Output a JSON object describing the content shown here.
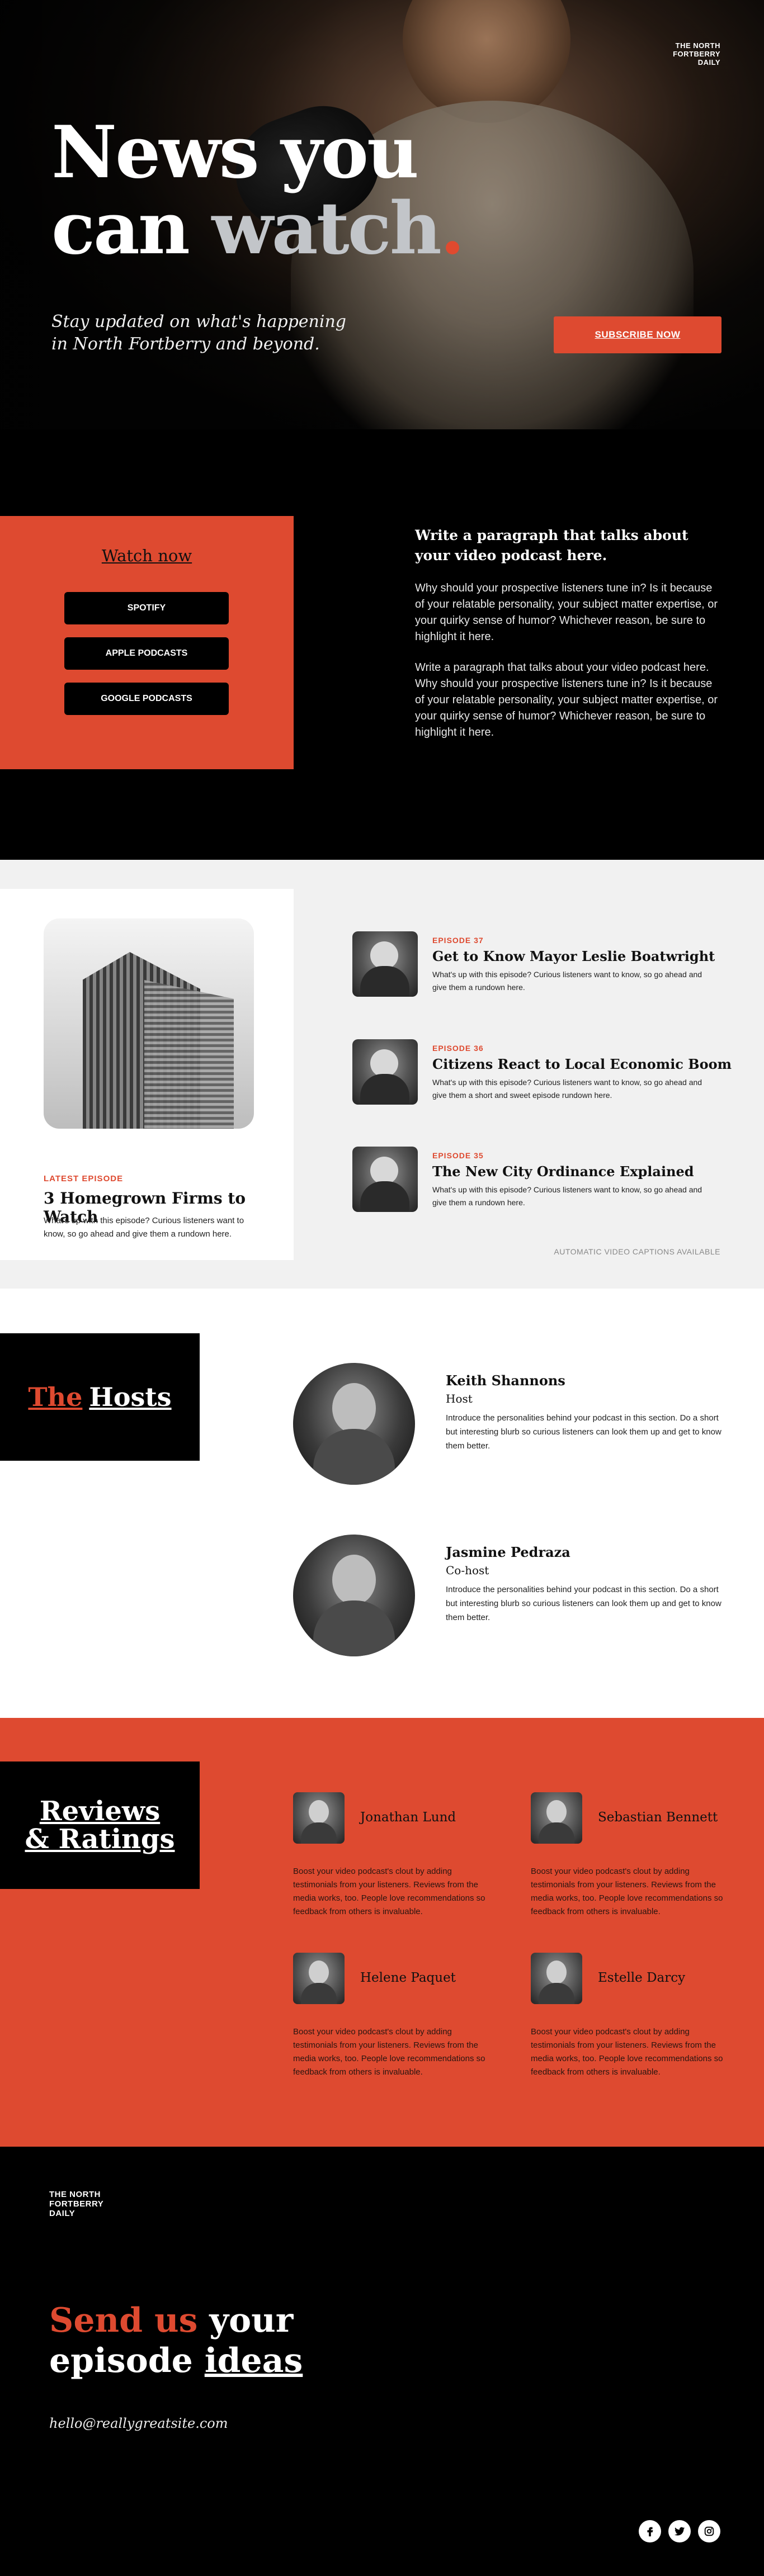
{
  "hero": {
    "brand_line1": "THE NORTH",
    "brand_line2": "FORTBERRY",
    "brand_line3": "DAILY",
    "headline_line1": "News you",
    "headline_can": "can",
    "headline_watch": "watch",
    "headline_dot": ".",
    "tagline": "Stay updated on what's happening in North Fortberry and beyond.",
    "subscribe_label": "SUBSCRIBE NOW"
  },
  "watch": {
    "title": "Watch now",
    "platforms": [
      "SPOTIFY",
      "APPLE PODCASTS",
      "GOOGLE PODCASTS"
    ],
    "heading": "Write a paragraph that talks about your video podcast here.",
    "para1": "Why should your prospective listeners tune in? Is it because of your relatable personality, your subject matter expertise, or your quirky sense of humor? Whichever reason, be sure to highlight it here.",
    "para2": "Write a paragraph that talks about your video podcast here. Why should your prospective listeners tune in? Is it because of your relatable personality, your subject matter expertise, or your quirky sense of humor? Whichever reason, be sure to highlight it here."
  },
  "episodes": {
    "latest_label": "LATEST EPISODE",
    "latest_title": "3 Homegrown Firms to Watch",
    "latest_desc": "What's up with this episode? Curious listeners want to know, so go ahead and give them a rundown here.",
    "items": [
      {
        "label": "EPISODE 37",
        "title": "Get to Know Mayor Leslie Boatwright",
        "desc": "What's up with this episode? Curious listeners want to know, so go ahead and give them a rundown here."
      },
      {
        "label": "EPISODE 36",
        "title": "Citizens React to Local Economic Boom",
        "desc": "What's up with this episode? Curious listeners want to know, so go ahead and give them a short and sweet episode rundown here."
      },
      {
        "label": "EPISODE 35",
        "title": "The New City Ordinance Explained",
        "desc": "What's up with this episode? Curious listeners want to know, so go ahead and give them a rundown here."
      }
    ],
    "captions": "AUTOMATIC VIDEO CAPTIONS AVAILABLE"
  },
  "hosts": {
    "title_the": "The",
    "title_hosts": "Hosts",
    "people": [
      {
        "name": "Keith Shannons",
        "role": "Host",
        "bio": "Introduce the personalities behind your podcast in this section. Do a short but interesting blurb so curious listeners can look them up and get to know them better."
      },
      {
        "name": "Jasmine Pedraza",
        "role": "Co-host",
        "bio": "Introduce the personalities behind your podcast in this section. Do a short but interesting blurb so curious listeners can look them up and get to know them better."
      }
    ]
  },
  "reviews": {
    "title_line1": "Reviews",
    "title_line2": "& Ratings",
    "items": [
      {
        "name": "Jonathan Lund",
        "text": "Boost your video podcast's clout by adding testimonials from your listeners. Reviews from the media works, too. People love recommendations so feedback from others is invaluable."
      },
      {
        "name": "Sebastian Bennett",
        "text": "Boost your video podcast's clout by adding testimonials from your listeners. Reviews from the media works, too. People love recommendations so feedback from others is invaluable."
      },
      {
        "name": "Helene Paquet",
        "text": "Boost your video podcast's clout by adding testimonials from your listeners. Reviews from the media works, too. People love recommendations so feedback from others is invaluable."
      },
      {
        "name": "Estelle Darcy",
        "text": "Boost your video podcast's clout by adding testimonials from your listeners. Reviews from the media works, too. People love recommendations so feedback from others is invaluable."
      }
    ]
  },
  "footer": {
    "brand_line1": "THE NORTH",
    "brand_line2": "FORTBERRY",
    "brand_line3": "DAILY",
    "cta_send_us": "Send us",
    "cta_your": "your",
    "cta_episode": "episode",
    "cta_ideas": "ideas",
    "email": "hello@reallygreatsite.com",
    "social_icons": [
      "facebook-icon",
      "twitter-icon",
      "instagram-icon"
    ]
  },
  "colors": {
    "accent": "#de4a30",
    "dark": "#000000",
    "light": "#f1f1f1"
  }
}
